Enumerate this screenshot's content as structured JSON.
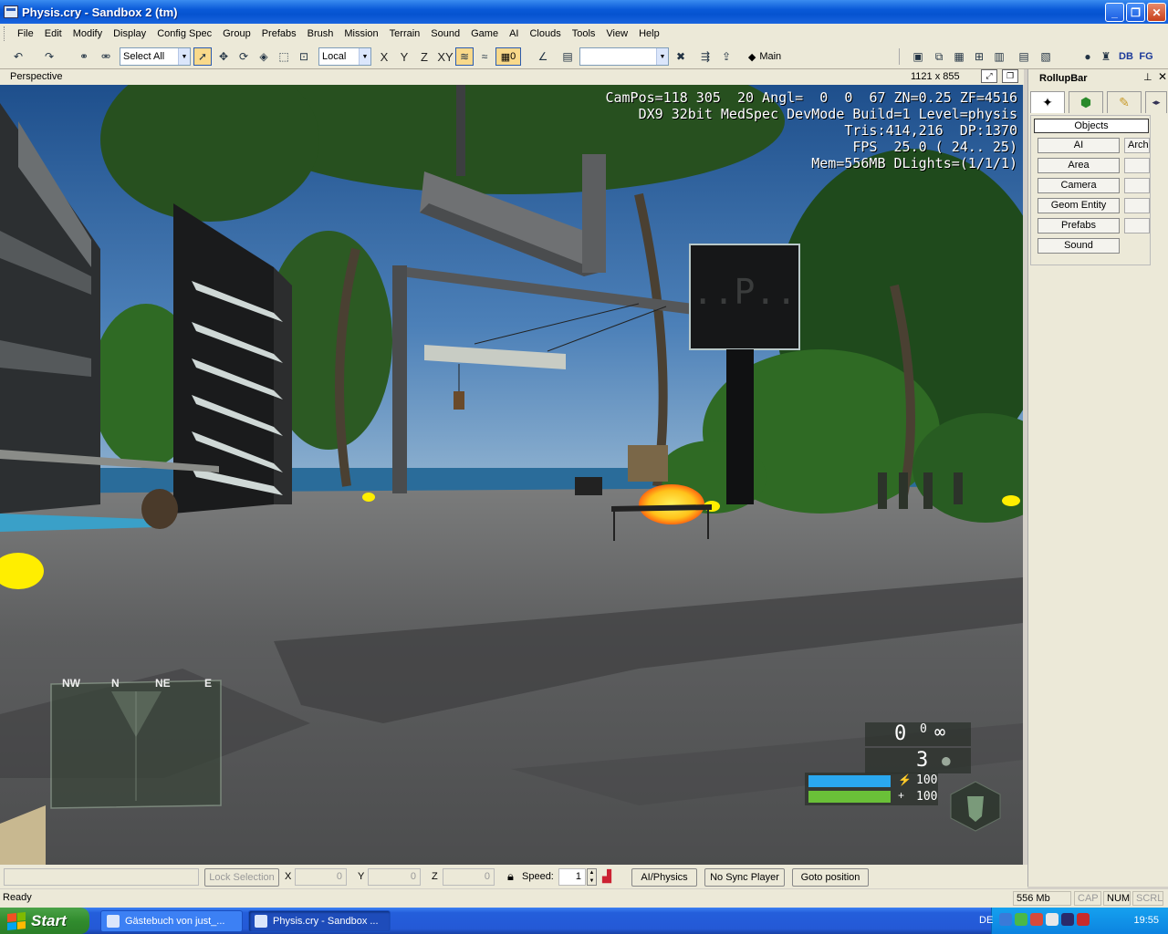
{
  "window": {
    "title": "Physis.cry - Sandbox 2 (tm)",
    "minimize_label": "_",
    "maximize_label": "❐",
    "close_label": "✕"
  },
  "menu": [
    "File",
    "Edit",
    "Modify",
    "Display",
    "Config Spec",
    "Group",
    "Prefabs",
    "Brush",
    "Mission",
    "Terrain",
    "Sound",
    "Game",
    "AI",
    "Clouds",
    "Tools",
    "View",
    "Help"
  ],
  "toolbar": {
    "selection_filter": "Select All",
    "coord_system": "Local",
    "axis_x": "X",
    "axis_y": "Y",
    "axis_z": "Z",
    "axis_xy": "XY",
    "grid_value": "0",
    "layer_label": "Main",
    "db_label": "DB",
    "fg_label": "FG"
  },
  "viewport": {
    "title": "Perspective",
    "resolution": "1121 x 855",
    "debug_lines": [
      "CamPos=118 305  20 Angl=  0  0  67 ZN=0.25 ZF=4516",
      "DX9 32bit MedSpec DevMode Build=1 Level=physis",
      "Tris:414,216  DP:1370",
      "FPS  25.0 ( 24.. 25)",
      "Mem=556MB DLights=(1/1/1)"
    ],
    "sign_text": "..P..",
    "hud": {
      "compass": [
        "NW",
        "N",
        "NE",
        "E"
      ],
      "ammo_clip": "0",
      "ammo_reserve": "0",
      "grenades": "3",
      "energy": "100",
      "health": "100",
      "energy_fraction": 1.0,
      "health_fraction": 1.0
    }
  },
  "rollup": {
    "title": "RollupBar",
    "objects_label": "Objects",
    "buttons": [
      "AI",
      "Area",
      "Camera",
      "Geom Entity",
      "Prefabs",
      "Sound"
    ],
    "second_column": [
      "Arche",
      "",
      "",
      "",
      "",
      ""
    ]
  },
  "bottombar": {
    "lock_selection": "Lock Selection",
    "x_label": "X",
    "x_value": "0",
    "y_label": "Y",
    "y_value": "0",
    "z_label": "Z",
    "z_value": "0",
    "speed_label": "Speed:",
    "speed_value": "1",
    "ai_physics": "AI/Physics",
    "no_sync_player": "No Sync Player",
    "goto_position": "Goto position"
  },
  "statusbar": {
    "status": "Ready",
    "memory": "556 Mb",
    "cap": "CAP",
    "num": "NUM",
    "scrl": "SCRL"
  },
  "taskbar": {
    "start": "Start",
    "tasks": [
      "Gästebuch von just_...",
      "Physis.cry - Sandbox ..."
    ],
    "lang": "DE",
    "clock": "19:55"
  },
  "colors": {
    "xp_blue": "#0553d0",
    "sky": "#3b6fa8",
    "ground": "#58595b",
    "energy": "#2aa8f0",
    "health": "#6ac038",
    "highlight_yellow": "#ffe800"
  }
}
